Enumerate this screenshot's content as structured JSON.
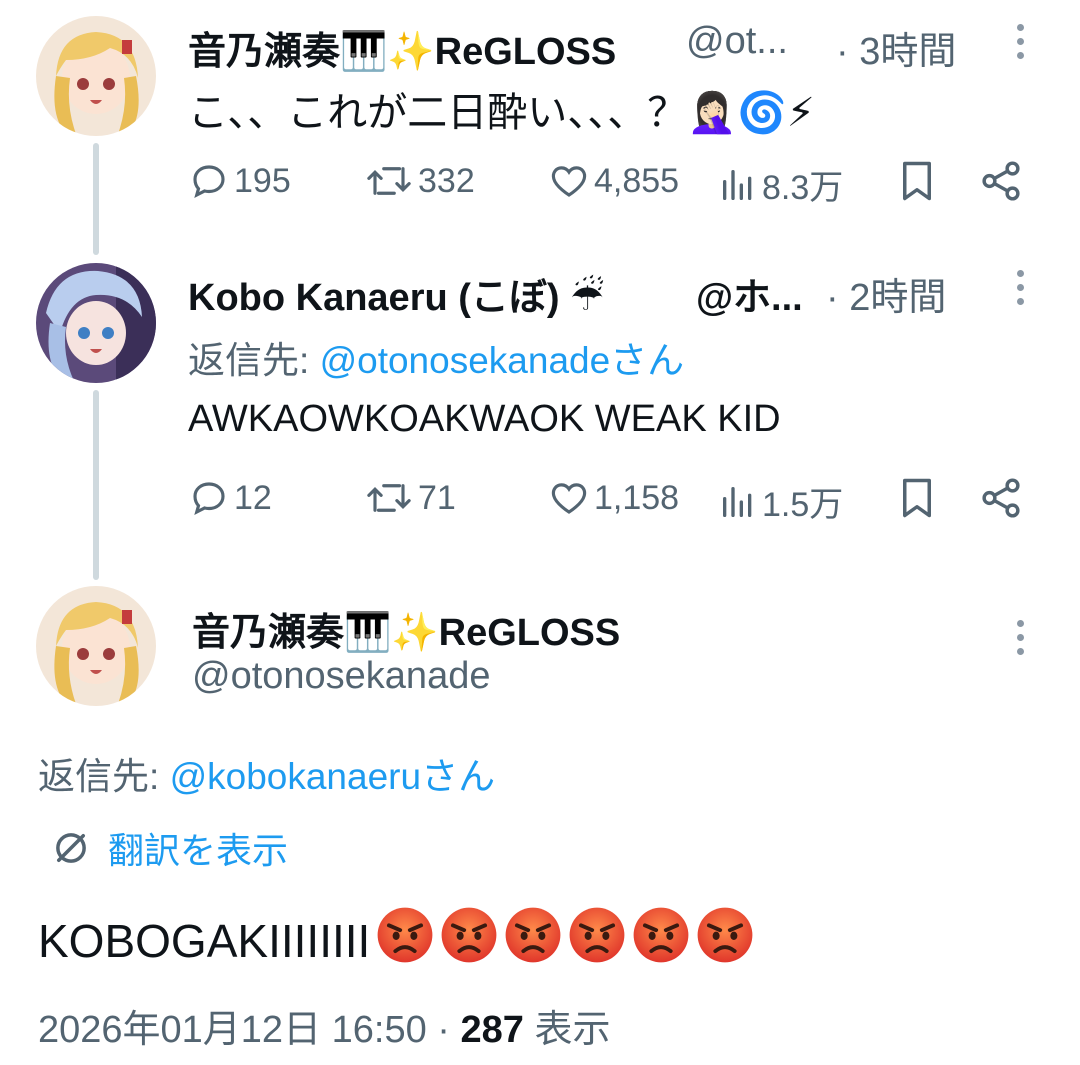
{
  "tweet1": {
    "name": "音乃瀬奏🎹✨ReGLOSS",
    "handle": "@ot...",
    "time": "· 3時間",
    "text": "こ、、これが二日酔い、、、？🤦🏻‍♀️🌀⚡",
    "stats": {
      "replies": "195",
      "retweets": "332",
      "likes": "4,855",
      "views": "8.3万"
    }
  },
  "tweet2": {
    "name": "Kobo Kanaeru (こぼ) ☔",
    "handle": "@ホ...",
    "time": "· 2時間",
    "reply_prefix": "返信先: ",
    "reply_to": "@otonosekanadeさん",
    "text": "AWKAOWKOAKWAOK WEAK KID",
    "stats": {
      "replies": "12",
      "retweets": "71",
      "likes": "1,158",
      "views": "1.5万"
    }
  },
  "main": {
    "name": "音乃瀬奏🎹✨ReGLOSS",
    "handle": "@otonosekanade",
    "reply_prefix": "返信先: ",
    "reply_to": "@kobokanaeruさん",
    "translate_label": "翻訳を表示",
    "text": "KOBOGAKIIIIIIII",
    "angry_count": 6,
    "timestamp": "2026年01月12日 16:50 · ",
    "views_count": "287",
    "views_label": " 表示"
  },
  "colors": {
    "accent": "#1d9bf0",
    "muted": "#536471",
    "text": "#0f1419",
    "line": "#cfd9de"
  },
  "icons": [
    "reply-icon",
    "retweet-icon",
    "like-icon",
    "views-icon",
    "bookmark-icon",
    "share-icon",
    "more-icon",
    "translate-icon",
    "angry-face-icon"
  ]
}
